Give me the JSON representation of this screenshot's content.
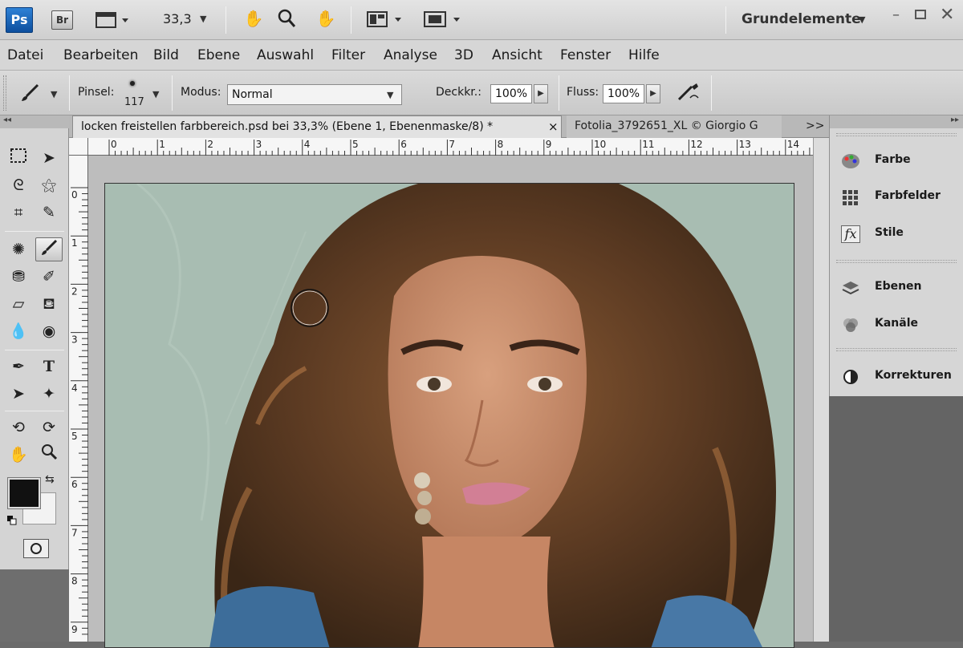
{
  "appbar": {
    "ps_label": "Ps",
    "br_label": "Br",
    "zoom_value": "33,3",
    "workspace": "Grundelemente"
  },
  "menu": [
    "Datei",
    "Bearbeiten",
    "Bild",
    "Ebene",
    "Auswahl",
    "Filter",
    "Analyse",
    "3D",
    "Ansicht",
    "Fenster",
    "Hilfe"
  ],
  "options": {
    "brush_label": "Pinsel:",
    "brush_size": "117",
    "mode_label": "Modus:",
    "mode_value": "Normal",
    "opacity_label": "Deckkr.:",
    "opacity_value": "100%",
    "flow_label": "Fluss:",
    "flow_value": "100%"
  },
  "tabs": {
    "active": "locken freistellen farbbereich.psd bei 33,3% (Ebene 1, Ebenenmaske/8) *",
    "close": "×",
    "inactive": "Fotolia_3792651_XL © Giorgio G",
    "overflow": ">>"
  },
  "ruler": {
    "top": [
      "0",
      "1",
      "2",
      "3",
      "4",
      "5",
      "6",
      "7",
      "8",
      "9",
      "10",
      "11",
      "12",
      "13",
      "14"
    ],
    "left": [
      "0",
      "1",
      "2",
      "3",
      "4",
      "5",
      "6",
      "7",
      "8",
      "9"
    ]
  },
  "panels": [
    {
      "label": "Farbe",
      "icon": "palette-icon"
    },
    {
      "label": "Farbfelder",
      "icon": "swatches-icon"
    },
    {
      "label": "Stile",
      "icon": "fx-icon"
    },
    {
      "label": "Ebenen",
      "icon": "layers-icon"
    },
    {
      "label": "Kanäle",
      "icon": "channels-icon"
    },
    {
      "label": "Korrekturen",
      "icon": "adjustments-icon"
    }
  ],
  "colors": {
    "foreground": "#111111",
    "background": "#f2f2f2",
    "ps_blue": "#1f6fc4",
    "doc_background": "#a8bdb2"
  }
}
